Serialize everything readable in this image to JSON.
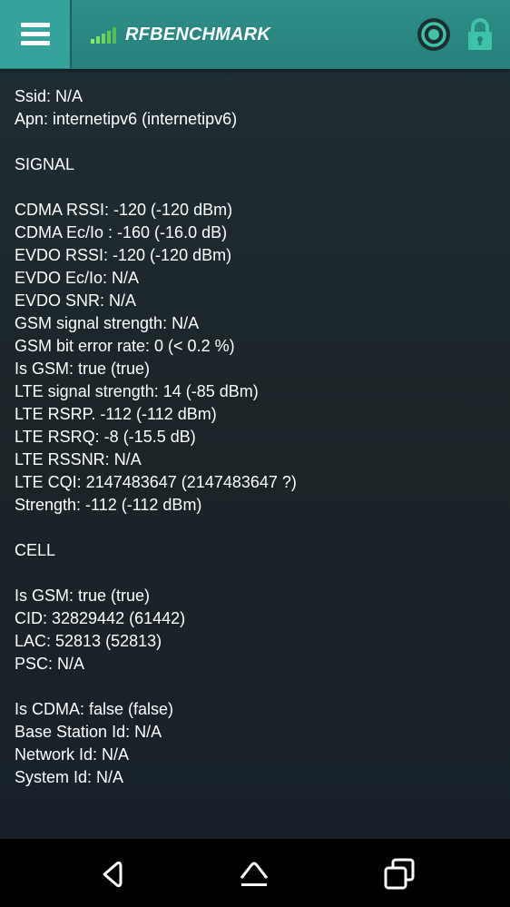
{
  "app_bar": {
    "brand": "RFBENCHMARK",
    "menu_icon": "hamburger-menu-icon",
    "record_icon": "record-icon",
    "lock_icon": "lock-icon"
  },
  "content": {
    "lines": [
      "Ssid: N/A",
      "Apn: internetipv6 (internetipv6)",
      "",
      "SIGNAL",
      "",
      "CDMA RSSI: -120 (-120 dBm)",
      "CDMA Ec/Io : -160 (-16.0 dB)",
      "EVDO RSSI: -120 (-120 dBm)",
      "EVDO Ec/Io: N/A",
      "EVDO SNR: N/A",
      "GSM signal strength: N/A",
      "GSM bit error rate: 0 (< 0.2 %)",
      "Is GSM: true (true)",
      "LTE signal strength: 14 (-85 dBm)",
      "LTE RSRP. -112 (-112 dBm)",
      "LTE RSRQ: -8 (-15.5 dB)",
      "LTE RSSNR: N/A",
      "LTE CQI: 2147483647 (2147483647 ?)",
      "Strength: -112 (-112 dBm)",
      "",
      "CELL",
      "",
      "Is GSM: true (true)",
      "CID: 32829442 (61442)",
      "LAC: 52813 (52813)",
      "PSC: N/A",
      "",
      "Is CDMA: false (false)",
      "Base Station Id: N/A",
      "Network Id: N/A",
      "System Id: N/A"
    ]
  },
  "nav_bar": {
    "back_icon": "back-icon",
    "home_icon": "home-icon",
    "recents_icon": "recents-icon"
  },
  "colors": {
    "app_bar": "#2f8e88",
    "menu_button": "#35a39c",
    "brand_bars": "#6fd35a",
    "lock": "#3fc3a8",
    "background": "#1c2529",
    "text": "#ffffff"
  }
}
